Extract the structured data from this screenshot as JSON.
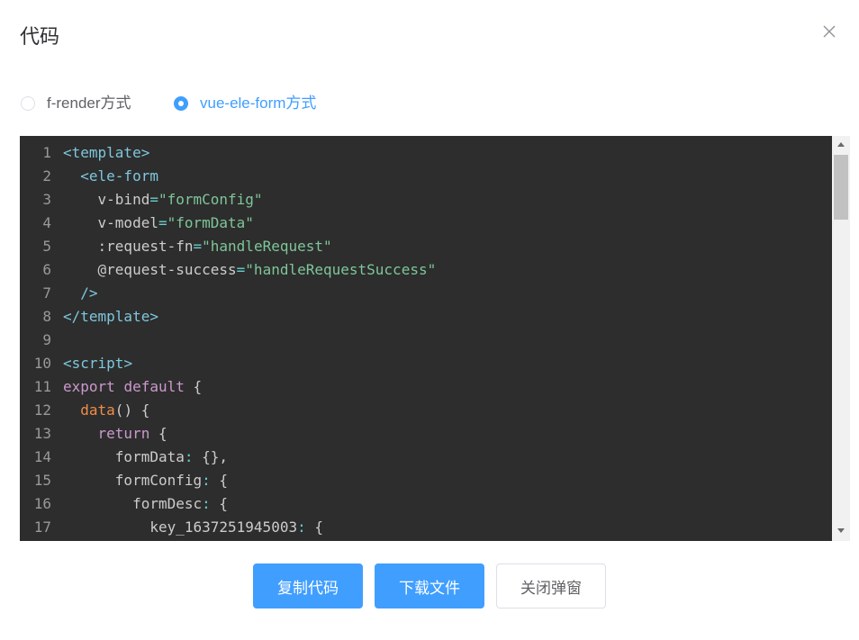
{
  "dialog": {
    "title": "代码"
  },
  "icons": {
    "close": "close-icon"
  },
  "mode_switch": {
    "options": [
      {
        "label": "f-render方式",
        "checked": false
      },
      {
        "label": "vue-ele-form方式",
        "checked": true
      }
    ]
  },
  "code": {
    "lines": [
      {
        "n": 1,
        "text": "<template>"
      },
      {
        "n": 2,
        "text": "  <ele-form"
      },
      {
        "n": 3,
        "text": "    v-bind=\"formConfig\""
      },
      {
        "n": 4,
        "text": "    v-model=\"formData\""
      },
      {
        "n": 5,
        "text": "    :request-fn=\"handleRequest\""
      },
      {
        "n": 6,
        "text": "    @request-success=\"handleRequestSuccess\""
      },
      {
        "n": 7,
        "text": "  />"
      },
      {
        "n": 8,
        "text": "</template>"
      },
      {
        "n": 9,
        "text": ""
      },
      {
        "n": 10,
        "text": "<script>"
      },
      {
        "n": 11,
        "text": "export default {"
      },
      {
        "n": 12,
        "text": "  data() {"
      },
      {
        "n": 13,
        "text": "    return {"
      },
      {
        "n": 14,
        "text": "      formData: {},"
      },
      {
        "n": 15,
        "text": "      formConfig: {"
      },
      {
        "n": 16,
        "text": "        formDesc: {"
      },
      {
        "n": 17,
        "text": "          key_1637251945003: {"
      }
    ]
  },
  "footer": {
    "copy_label": "复制代码",
    "download_label": "下载文件",
    "close_label": "关闭弹窗"
  },
  "colors": {
    "accent": "#409EFF",
    "editor-bg": "#2d2d2d",
    "line-number": "#999999",
    "syntax-text": "#cccccc",
    "syntax-tag": "#7ec7dd",
    "syntax-attr": "#cccccc",
    "syntax-operator": "#67cdcc",
    "syntax-string": "#7ec699",
    "syntax-keyword": "#cc99cd",
    "syntax-function": "#f08d49"
  }
}
